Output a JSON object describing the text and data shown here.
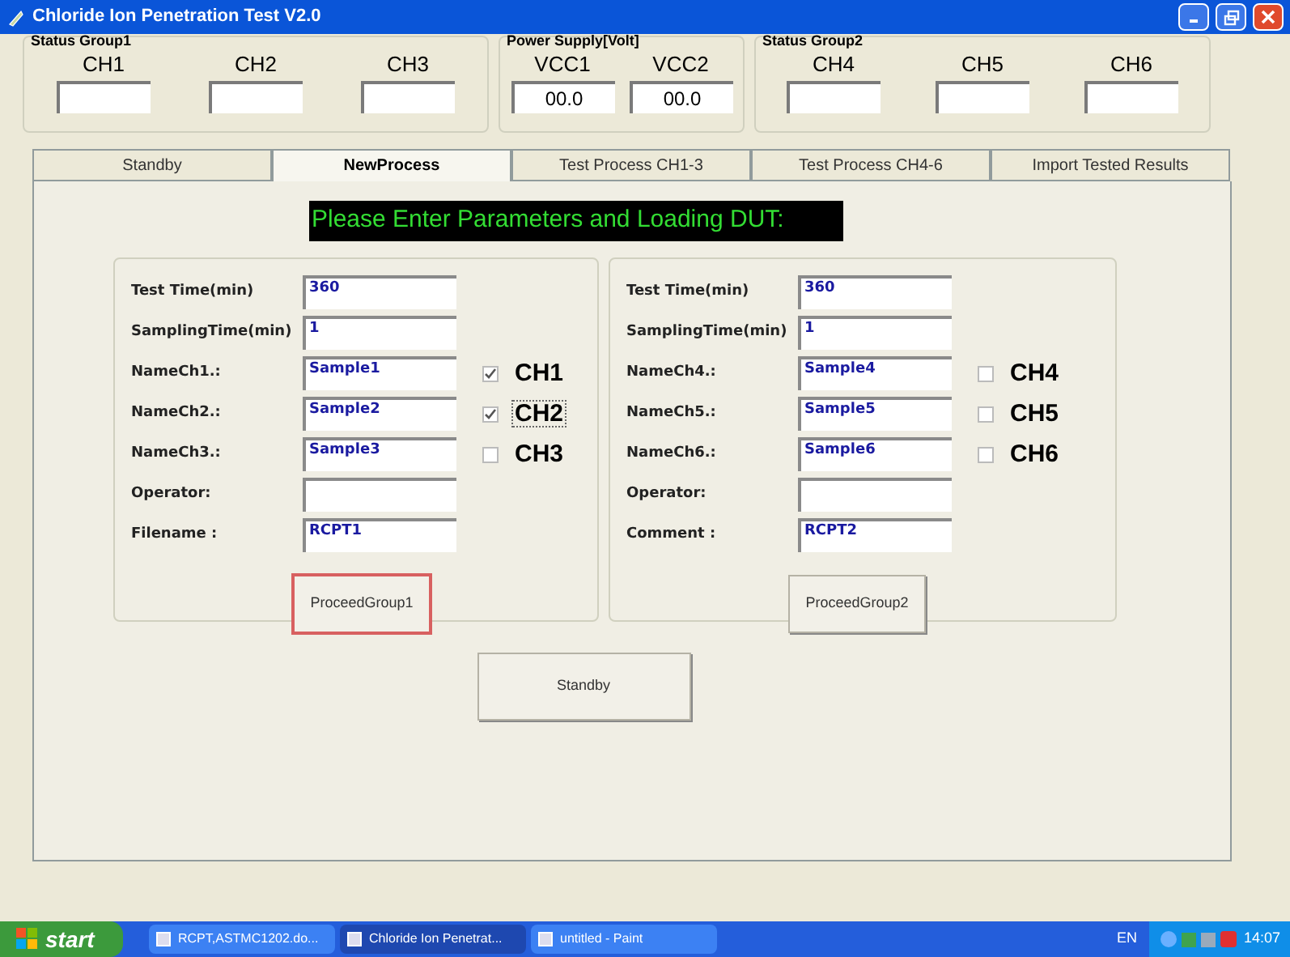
{
  "window": {
    "title": "Chloride Ion Penetration Test V2.0"
  },
  "status_groups": [
    {
      "label": "Status Group1",
      "channels": [
        {
          "label": "CH1"
        },
        {
          "label": "CH2"
        },
        {
          "label": "CH3"
        }
      ]
    },
    {
      "label": "Power Supply[Volt]",
      "channels": [
        {
          "label": "VCC1",
          "value": "00.0"
        },
        {
          "label": "VCC2",
          "value": "00.0"
        }
      ]
    },
    {
      "label": "Status Group2",
      "channels": [
        {
          "label": "CH4"
        },
        {
          "label": "CH5"
        },
        {
          "label": "CH6"
        }
      ]
    }
  ],
  "tabs": [
    {
      "label": "Standby",
      "selected": false
    },
    {
      "label": "NewProcess",
      "selected": true
    },
    {
      "label": "Test Process CH1-3",
      "selected": false
    },
    {
      "label": "Test Process CH4-6",
      "selected": false
    },
    {
      "label": "Import Tested Results",
      "selected": false
    }
  ],
  "banner": "Please Enter Parameters and Loading DUT:",
  "groups": [
    {
      "fields": [
        {
          "label": "Test Time(min)",
          "value": "360"
        },
        {
          "label": "SamplingTime(min)",
          "value": "1"
        },
        {
          "label": "NameCh1.:",
          "value": "Sample1"
        },
        {
          "label": "NameCh2.:",
          "value": "Sample2"
        },
        {
          "label": "NameCh3.:",
          "value": "Sample3"
        },
        {
          "label": "Operator:"
        },
        {
          "label": "Filename :",
          "value": "RCPT1"
        }
      ],
      "channels": [
        {
          "label": "CH1",
          "checked": true,
          "focused": false
        },
        {
          "label": "CH2",
          "checked": true,
          "focused": true
        },
        {
          "label": "CH3",
          "checked": false,
          "focused": false
        }
      ],
      "button": {
        "label": "ProceedGroup1",
        "focused": true
      }
    },
    {
      "fields": [
        {
          "label": "Test Time(min)",
          "value": "360"
        },
        {
          "label": "SamplingTime(min)",
          "value": "1"
        },
        {
          "label": "NameCh4.:",
          "value": "Sample4"
        },
        {
          "label": "NameCh5.:",
          "value": "Sample5"
        },
        {
          "label": "NameCh6.:",
          "value": "Sample6"
        },
        {
          "label": "Operator:"
        },
        {
          "label": "Comment :",
          "value": "RCPT2"
        }
      ],
      "channels": [
        {
          "label": "CH4",
          "checked": false,
          "focused": false
        },
        {
          "label": "CH5",
          "checked": false,
          "focused": false
        },
        {
          "label": "CH6",
          "checked": false,
          "focused": false
        }
      ],
      "button": {
        "label": "ProceedGroup2",
        "focused": false
      }
    }
  ],
  "standby_button": "Standby",
  "taskbar": {
    "start": "start",
    "tasks": [
      {
        "label": "RCPT,ASTMC1202.do...",
        "selected": false
      },
      {
        "label": "Chloride Ion Penetrat...",
        "selected": true
      },
      {
        "label": "untitled - Paint",
        "selected": false
      }
    ],
    "language": "EN",
    "clock": "14:07"
  }
}
